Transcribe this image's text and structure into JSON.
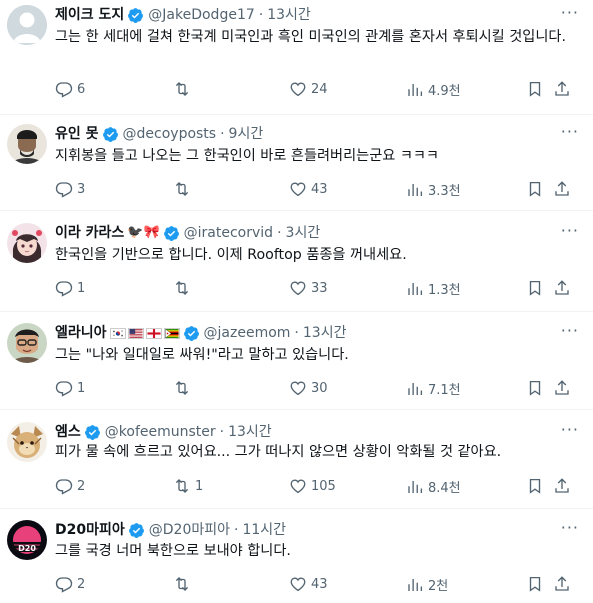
{
  "tweets": [
    {
      "name": "제이크 도지",
      "handle": "@JakeDodge17",
      "time": "13시간",
      "text": "그는 한 세대에 걸쳐 한국계 미국인과 흑인 미국인의 관계를 혼자서 후퇴시킬 것입니다.",
      "replies": "6",
      "retweets": "",
      "likes": "24",
      "views": "4.9천",
      "verified": true,
      "emoji": ""
    },
    {
      "name": "유인 못",
      "handle": "@decoyposts",
      "time": "9시간",
      "text": "지휘봉을 들고 나오는 그 한국인이 바로 흔들려버리는군요 ㅋㅋㅋ",
      "replies": "3",
      "retweets": "",
      "likes": "43",
      "views": "3.3천",
      "verified": true,
      "emoji": ""
    },
    {
      "name": "이라 카라스",
      "handle": "@iratecorvid",
      "time": "3시간",
      "text": "한국인을 기반으로 합니다. 이제 Rooftop 품종을 꺼내세요.",
      "replies": "1",
      "retweets": "",
      "likes": "33",
      "views": "1.3천",
      "verified": true,
      "emoji": "🐦‍⬛🎀"
    },
    {
      "name": "엘라니아",
      "handle": "@jazeemom",
      "time": "13시간",
      "text": "그는 \"나와 일대일로 싸워!\"라고 말하고 있습니다.",
      "replies": "1",
      "retweets": "",
      "likes": "30",
      "views": "7.1천",
      "verified": true,
      "emoji": ""
    },
    {
      "name": "엠스",
      "handle": "@kofeemunster",
      "time": "13시간",
      "text": "피가 물 속에 흐르고 있어요... 그가 떠나지 않으면 상황이 악화될 것 같아요.",
      "replies": "2",
      "retweets": "1",
      "likes": "105",
      "views": "8.4천",
      "verified": true,
      "emoji": ""
    },
    {
      "name": "D20마피아",
      "handle": "@D20마피아",
      "time": "11시간",
      "text": "그를 국경 너머 북한으로 보내야 합니다.",
      "replies": "2",
      "retweets": "",
      "likes": "43",
      "views": "2천",
      "verified": true,
      "emoji": ""
    }
  ],
  "more_label": "···",
  "separator": "·",
  "colors": {
    "verified": "#1d9bf0",
    "muted": "#536471",
    "text": "#0f1419"
  }
}
